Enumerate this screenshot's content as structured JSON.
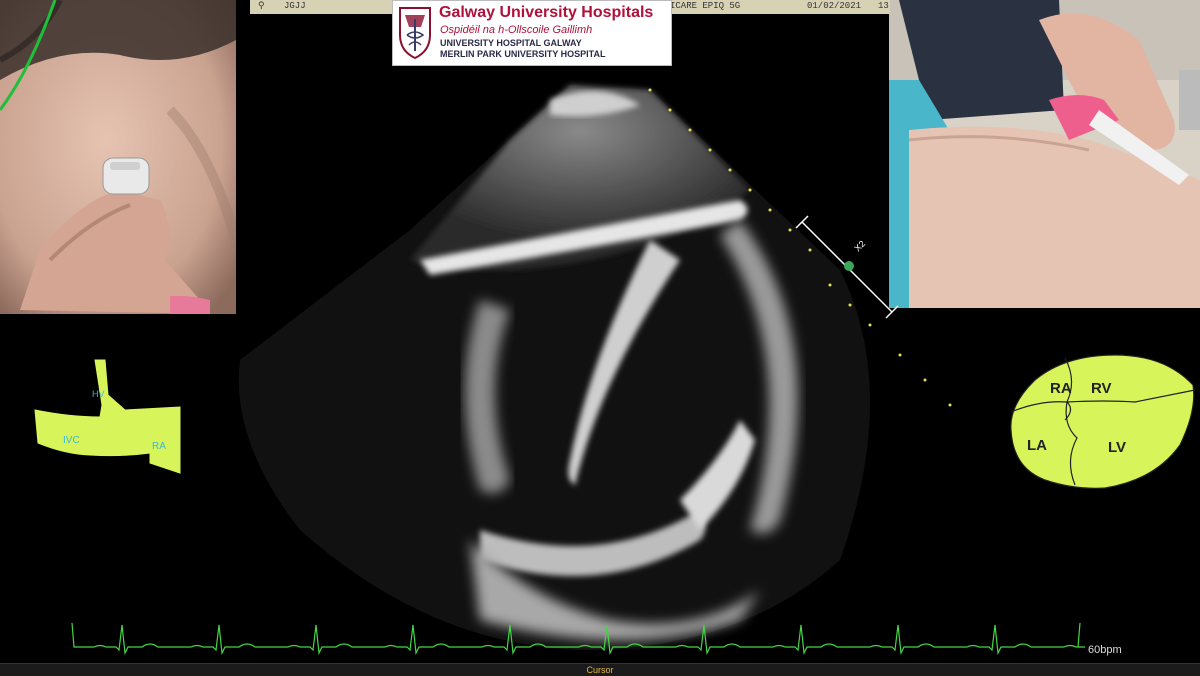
{
  "status_bar": {
    "patient_id": "JGJJ",
    "system": "ICARE  EPIQ 5G",
    "date": "01/02/2021",
    "time": "13"
  },
  "logo": {
    "title": "Galway University Hospitals",
    "irish_name": "Ospidéil na h-Ollscoile Gaillimh",
    "line1": "UNIVERSITY HOSPITAL GALWAY",
    "line2": "MERLIN PARK UNIVERSITY HOSPITAL"
  },
  "echo": {
    "scale_label": "X2"
  },
  "ivc_diagram": {
    "labels": {
      "hv": "HV",
      "ivc": "IVC",
      "ra": "RA"
    },
    "fill_color": "#d7f55a",
    "label_color": "#3ab7d8"
  },
  "heart_diagram": {
    "labels": {
      "ra": "RA",
      "rv": "RV",
      "la": "LA",
      "lv": "LV"
    },
    "fill_color": "#d7f55a"
  },
  "ecg": {
    "heart_rate": "60bpm",
    "trace_color": "#45d645"
  },
  "bottom_bar": {
    "label": "Cursor"
  }
}
